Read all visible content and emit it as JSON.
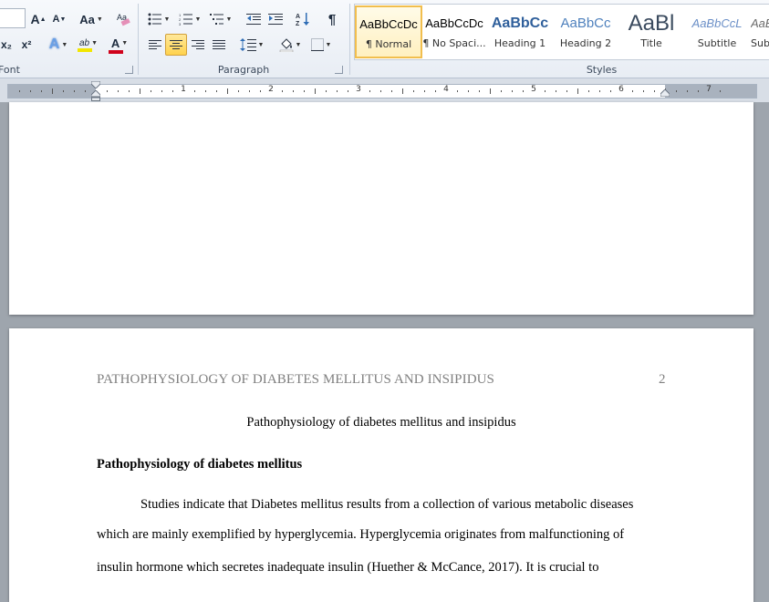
{
  "ribbon": {
    "font_group": {
      "label": "Font",
      "grow_font": "A",
      "shrink_font": "A",
      "change_case": "Aa",
      "clear_format_icon": "clear-formatting-icon",
      "subscript": "x₂",
      "superscript": "x²",
      "text_effects": "A",
      "highlight": "ab",
      "font_color": "A",
      "highlight_color": "#f2e600",
      "font_color_value": "#d0021b"
    },
    "paragraph_group": {
      "label": "Paragraph",
      "show_marks": "¶",
      "sort": "A↓Z"
    },
    "styles_group": {
      "label": "Styles",
      "items": [
        {
          "sample": "AaBbCcDc",
          "name": "¶ Normal",
          "selected": true
        },
        {
          "sample": "AaBbCcDc",
          "name": "¶ No Spaci..."
        },
        {
          "sample": "AaBbCc",
          "name": "Heading 1"
        },
        {
          "sample": "AaBbCc",
          "name": "Heading 2"
        },
        {
          "sample": "AaBl",
          "name": "Title"
        },
        {
          "sample": "AaBbCcL",
          "name": "Subtitle"
        },
        {
          "sample": "AaBbCcL",
          "name": "Sub"
        }
      ]
    }
  },
  "ruler": {
    "numbers": [
      "1",
      "2",
      "3",
      "4",
      "5",
      "6",
      "7"
    ]
  },
  "document": {
    "running_head": "PATHOPHYSIOLOGY OF DIABETES MELLITUS AND INSIPIDUS",
    "page_number": "2",
    "title": "Pathophysiology of diabetes mellitus and insipidus",
    "heading": "Pathophysiology of diabetes mellitus",
    "lines": [
      "Studies indicate that Diabetes mellitus results from a collection of various metabolic diseases",
      "which are mainly exemplified by hyperglycemia. Hyperglycemia originates from malfunctioning of",
      "insulin hormone which secretes inadequate insulin (Huether & McCance, 2017). It is crucial  to"
    ]
  }
}
